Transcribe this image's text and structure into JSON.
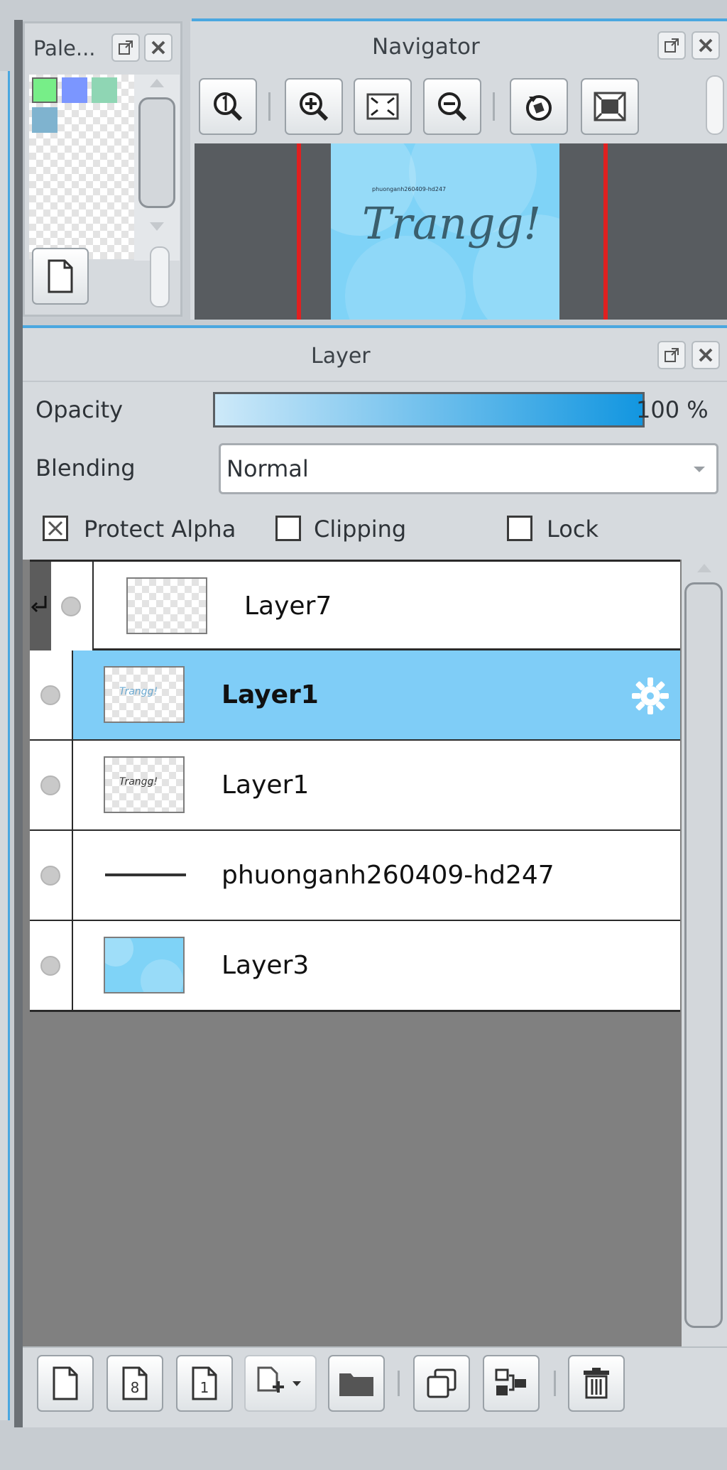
{
  "palette": {
    "title": "Pale...",
    "swatches": [
      "#77ee88",
      "#7b96ff",
      "#8fd6b4",
      "#7fb3cf"
    ]
  },
  "navigator": {
    "title": "Navigator",
    "preview_text": "Trangg!",
    "preview_subtext": "phuonganh260409-hd247"
  },
  "layer_panel": {
    "title": "Layer",
    "opacity_label": "Opacity",
    "opacity_value": "100 %",
    "opacity_fraction": 1.0,
    "blending_label": "Blending",
    "blending_value": "Normal",
    "protect_alpha_label": "Protect Alpha",
    "clipping_label": "Clipping",
    "lock_label": "Lock",
    "layers": [
      {
        "name": "Layer7",
        "clipped": true,
        "selected": false
      },
      {
        "name": "Layer1",
        "clipped": false,
        "selected": true
      },
      {
        "name": "Layer1",
        "clipped": false,
        "selected": false
      },
      {
        "name": "phuonganh260409-hd247",
        "clipped": false,
        "selected": false
      },
      {
        "name": "Layer3",
        "clipped": false,
        "selected": false
      }
    ]
  },
  "colors": {
    "selected_row": "#7fcdf7",
    "accent": "#1296e0",
    "preview_bg": "#7fd3f7"
  }
}
